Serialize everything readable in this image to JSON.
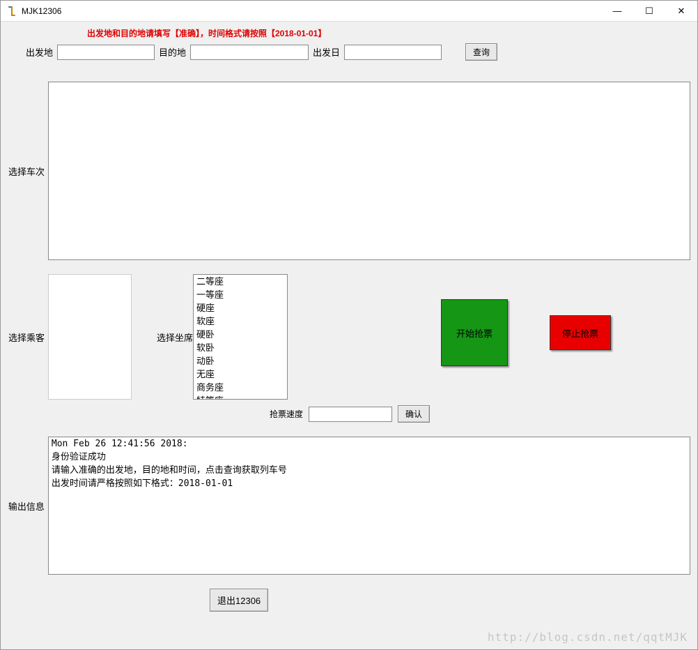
{
  "window": {
    "title": "MJK12306"
  },
  "titlebar_icons": {
    "minimize": "—",
    "maximize": "☐",
    "close": "✕"
  },
  "instruction": "出发地和目的地请填写【准确】，时间格式请按照【2018-01-01】",
  "search": {
    "departure_label": "出发地",
    "departure_value": "",
    "destination_label": "目的地",
    "destination_value": "",
    "date_label": "出发日",
    "date_value": "",
    "query_button": "查询"
  },
  "train_section": {
    "label": "选择车次",
    "value": ""
  },
  "passenger_section": {
    "label": "选择乘客"
  },
  "seat_section": {
    "label": "选择坐席",
    "options": [
      "二等座",
      "一等座",
      "硬座",
      "软座",
      "硬卧",
      "软卧",
      "动卧",
      "无座",
      "商务座",
      "特等座"
    ]
  },
  "actions": {
    "start_label": "开始抢票",
    "stop_label": "停止抢票"
  },
  "speed": {
    "label": "抢票速度",
    "value": "",
    "confirm": "确认"
  },
  "output": {
    "label": "输出信息",
    "text": "Mon Feb 26 12:41:56 2018:\n身份验证成功\n请输入准确的出发地，目的地和时间，点击查询获取列车号\n出发时间请严格按照如下格式：2018-01-01"
  },
  "exit": {
    "label": "退出12306"
  },
  "watermark": "http://blog.csdn.net/qqtMJK"
}
